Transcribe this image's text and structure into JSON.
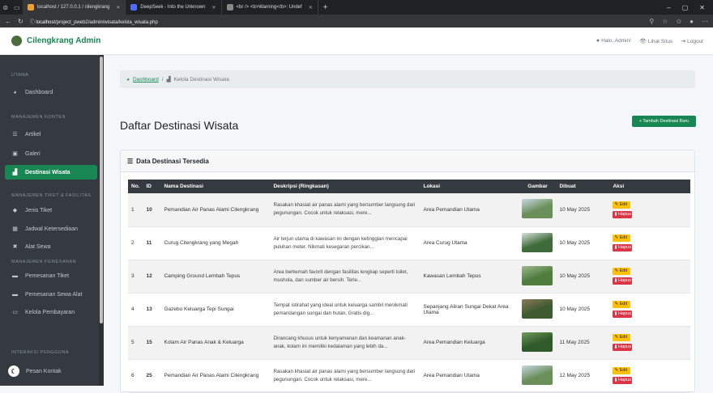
{
  "browser": {
    "tabs": [
      {
        "label": "localhost / 127.0.0.1 / cilengkrang",
        "color": "#f0a030",
        "active": true
      },
      {
        "label": "DeepSeek - Into the Unknown",
        "color": "#4d6bfe",
        "active": false
      },
      {
        "label": "<br /> <b>Warning</b>: Undef",
        "color": "#888888",
        "active": false
      }
    ],
    "url_host": "localhost",
    "url_path": "/project_pweb2/admin/wisata/kelola_wisata.php"
  },
  "topnav": {
    "brand": "Cilengkrang Admin",
    "greeting": "Halo, Admin!",
    "view_site": "Lihat Situs",
    "logout": "Logout"
  },
  "sidebar": {
    "sections": [
      {
        "heading": "UTAMA",
        "items": [
          {
            "label": "Dashboard",
            "icon": "dashboard-icon",
            "active": false
          }
        ]
      },
      {
        "heading": "MANAJEMEN KONTEN",
        "items": [
          {
            "label": "Artikel",
            "icon": "list-icon",
            "active": false
          },
          {
            "label": "Galeri",
            "icon": "image-icon",
            "active": false
          },
          {
            "label": "Destinasi Wisata",
            "icon": "map-icon",
            "active": true
          }
        ]
      },
      {
        "heading": "MANAJEMEN TIKET & FASILITAS",
        "items": [
          {
            "label": "Jenis Tiket",
            "icon": "tag-icon",
            "active": false
          },
          {
            "label": "Jadwal Ketersediaan",
            "icon": "calendar-icon",
            "active": false
          },
          {
            "label": "Alat Sewa",
            "icon": "tools-icon",
            "active": false
          }
        ]
      },
      {
        "heading": "MANAJEMEN PEMESANAN",
        "items": [
          {
            "label": "Pemesanan Tiket",
            "icon": "ticket-icon",
            "active": false
          },
          {
            "label": "Pemesanan Sewa Alat",
            "icon": "truck-icon",
            "active": false
          },
          {
            "label": "Kelola Pembayaran",
            "icon": "payment-icon",
            "active": false
          }
        ]
      },
      {
        "heading": "INTERAKSI PENGGUNA",
        "items": [
          {
            "label": "Pesan Kontak",
            "icon": "envelope-icon",
            "active": false
          }
        ]
      }
    ]
  },
  "breadcrumb": {
    "home": "Dashboard",
    "separator": "/",
    "current": "Kelola Destinasi Wisata"
  },
  "page": {
    "title": "Daftar Destinasi Wisata",
    "add_button": "+ Tambah Destinasi Baru",
    "card_title": "Data Destinasi Tersedia"
  },
  "table": {
    "headers": [
      "No.",
      "ID",
      "Nama Destinasi",
      "Deskripsi (Ringkasan)",
      "Lokasi",
      "Gambar",
      "Dibuat",
      "Aksi"
    ],
    "edit_label": "Edit",
    "delete_label": "Hapus",
    "rows": [
      {
        "no": "1",
        "id": "10",
        "name": "Pemandian Air Panas Alami Cilengkrang",
        "desc": "Rasakan khasiat air panas alami yang bersumber langsung dari pegunungan. Cocok untuk relaksasi, mere...",
        "location": "Area Pemandian Utama",
        "created": "10 May 2025",
        "img": [
          "#6a8f5a",
          "#c9d8e2"
        ]
      },
      {
        "no": "2",
        "id": "11",
        "name": "Curug Cilengkrang yang Megah",
        "desc": "Air terjun utama di kawasan ini dengan ketinggian mencapai puluhan meter. Nikmati kesegaran percikan...",
        "location": "Area Curug Utama",
        "created": "10 May 2025",
        "img": [
          "#3f6b3a",
          "#d8e2dc"
        ]
      },
      {
        "no": "3",
        "id": "12",
        "name": "Camping Ground Lembah Tepus",
        "desc": "Area berkemah favorit dengan fasilitas lengkap seperti toilet, mushola, dan sumber air bersih. Terle...",
        "location": "Kawasan Lembah Tepus",
        "created": "10 May 2025",
        "img": [
          "#4f7d3e",
          "#9fb88f"
        ]
      },
      {
        "no": "4",
        "id": "13",
        "name": "Gazebo Keluarga Tepi Sungai",
        "desc": "Tempat istirahat yang ideal untuk keluarga sambil menikmati pemandangan sungai dan hutan. Gratis dig...",
        "location": "Sepanjang Aliran Sungai Dekat Area Utama",
        "created": "10 May 2025",
        "img": [
          "#3e5a30",
          "#8a7a5a"
        ]
      },
      {
        "no": "5",
        "id": "15",
        "name": "Kolam Air Panas Anak & Keluarga",
        "desc": "Dirancang khusus untuk kenyamanan dan keamanan anak-anak, kolam ini memiliki kedalaman yang lebih da...",
        "location": "Area Pemandian Keluarga",
        "created": "11 May 2025",
        "img": [
          "#2f5a2a",
          "#6f9a5e"
        ]
      },
      {
        "no": "6",
        "id": "25",
        "name": "Pemandian Air Panas Alami Cilengkrang",
        "desc": "Rasakan khasiat air panas alami yang bersumber langsung dari pegunungan. Cocok untuk relaksasi, mere...",
        "location": "Area Pemandian Utama",
        "created": "12 May 2025",
        "img": [
          "#6a8f5a",
          "#c9d8e2"
        ]
      }
    ]
  }
}
